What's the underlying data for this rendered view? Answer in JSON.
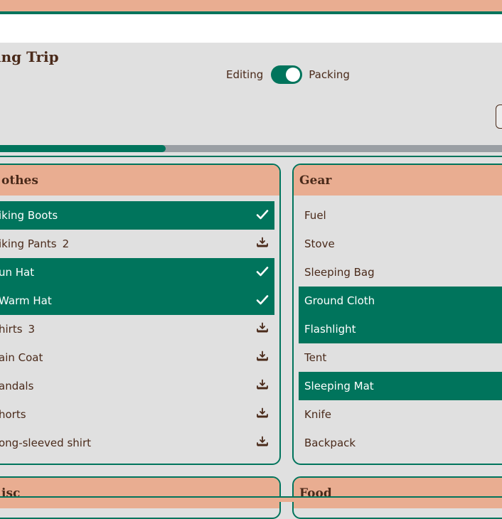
{
  "header": {
    "title": "ing Trip"
  },
  "mode": {
    "left_label": "Editing",
    "right_label": "Packing",
    "packing_on": true
  },
  "progress": {
    "fraction": 0.33
  },
  "categories": [
    {
      "name": "othes",
      "items": [
        {
          "label": "iking Boots",
          "qty": "",
          "packed": true
        },
        {
          "label": "iking Pants",
          "qty": "2",
          "packed": false
        },
        {
          "label": "un Hat",
          "qty": "",
          "packed": true
        },
        {
          "label": "Warm Hat",
          "qty": "",
          "packed": true
        },
        {
          "label": "hirts",
          "qty": "3",
          "packed": false
        },
        {
          "label": "ain Coat",
          "qty": "",
          "packed": false
        },
        {
          "label": "andals",
          "qty": "",
          "packed": false
        },
        {
          "label": "horts",
          "qty": "",
          "packed": false
        },
        {
          "label": "ong-sleeved shirt",
          "qty": "",
          "packed": false
        }
      ]
    },
    {
      "name": "Gear",
      "items": [
        {
          "label": "Fuel",
          "packed": false
        },
        {
          "label": "Stove",
          "packed": false
        },
        {
          "label": "Sleeping Bag",
          "packed": false
        },
        {
          "label": "Ground Cloth",
          "packed": true
        },
        {
          "label": "Flashlight",
          "packed": true
        },
        {
          "label": "Tent",
          "packed": false
        },
        {
          "label": "Sleeping Mat",
          "packed": true
        },
        {
          "label": "Knife",
          "packed": false
        },
        {
          "label": "Backpack",
          "packed": false
        }
      ]
    },
    {
      "name": "isc"
    },
    {
      "name": "Food"
    }
  ],
  "colors": {
    "accent": "#00745c",
    "header": "#e9ad91",
    "text": "#4a2a1a",
    "background": "#e0e0e0"
  },
  "icons": {
    "packed": "check-icon",
    "unpacked": "pack-tray-icon"
  }
}
